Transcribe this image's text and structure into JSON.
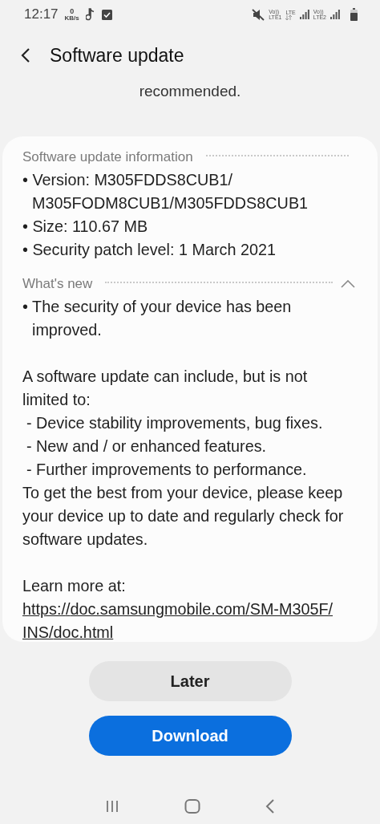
{
  "status_bar": {
    "time": "12:17",
    "speed_value": "0",
    "speed_unit": "KB/s",
    "sim1_volte": "Vo))",
    "sim1_label": "LTE1",
    "network": "LTE",
    "sim2_volte": "Vo))",
    "sim2_label": "LTE2"
  },
  "header": {
    "title": "Software update"
  },
  "intro_tail": "recommended.",
  "sections": [
    {
      "title": "Software update information",
      "paragraphs": [
        {
          "lines": [
            {
              "kind": "bullet",
              "text": "• Version: M305FDDS8CUB1/M305FODM8CUB1/M305FDDS8CUB1"
            },
            {
              "kind": "bullet",
              "text": "• Size: 110.67 MB"
            },
            {
              "kind": "bullet",
              "text": "• Security patch level: 1 March 2021"
            }
          ]
        }
      ]
    },
    {
      "title": "What's new",
      "expanded": true,
      "paragraphs": [
        {
          "lines": [
            {
              "kind": "bullet",
              "text": "• The security of your device has been improved."
            }
          ]
        },
        {
          "lines": [
            {
              "kind": "text",
              "text": "A software update can include, but is not limited to:"
            },
            {
              "kind": "indented",
              "text": "- Device stability improvements, bug fixes."
            },
            {
              "kind": "indented",
              "text": "- New and / or enhanced features."
            },
            {
              "kind": "indented",
              "text": "- Further improvements to performance."
            },
            {
              "kind": "text",
              "text": "To get the best from your device, please keep your device up to date and regularly check for software updates."
            }
          ]
        },
        {
          "lines": [
            {
              "kind": "text",
              "text": "Learn more at:"
            },
            {
              "kind": "link",
              "text": "https://doc.samsungmobile.com/SM-M305F/INS/doc.html"
            }
          ]
        }
      ]
    }
  ],
  "buttons": [
    {
      "label": "Later",
      "primary": false
    },
    {
      "label": "Download",
      "primary": true
    }
  ]
}
